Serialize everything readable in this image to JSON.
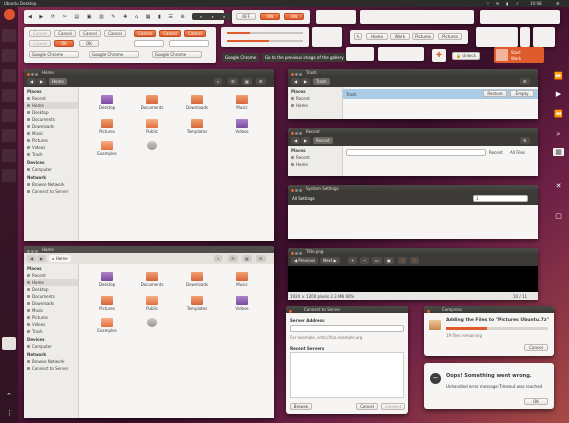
{
  "topbar": {
    "title": "Ubuntu Desktop",
    "clock": "10:08"
  },
  "launcher": {
    "items": [
      "home",
      "files",
      "browser",
      "software",
      "settings",
      "trash",
      "apps"
    ]
  },
  "widgets": {
    "cancel": "Cancel",
    "ok": "OK",
    "combo": "Google Chrome",
    "tooltip": "Google Chrome",
    "tooltip2": "Go to the previous image of the gallery",
    "path": [
      "Home",
      "Work",
      "Pictures"
    ],
    "crumb": "Pictures",
    "unlock": "Unlock",
    "user": {
      "name": "Start",
      "sub": "Work"
    }
  },
  "home1": {
    "title": "Home",
    "path": "Home",
    "places_h": "Places",
    "places": [
      "Recent",
      "Home",
      "Desktop",
      "Documents",
      "Downloads",
      "Music",
      "Pictures",
      "Videos",
      "Trash"
    ],
    "devices_h": "Devices",
    "devices": [
      "Computer"
    ],
    "network_h": "Network",
    "network": [
      "Browse Network",
      "Connect to Server"
    ],
    "files": [
      "Desktop",
      "Documents",
      "Downloads",
      "Music",
      "Pictures",
      "Public",
      "Templates",
      "Videos",
      "Examples",
      ""
    ]
  },
  "home2": {
    "title": "Home",
    "path": "Home"
  },
  "trash": {
    "title": "Trash",
    "path": "Trash",
    "places_h": "Places",
    "places": [
      "Recent",
      "Home"
    ],
    "label": "Trash",
    "restore": "Restore",
    "empty": "Empty"
  },
  "recent": {
    "title": "Recent",
    "places_h": "Places",
    "places": [
      "Recent",
      "Home"
    ],
    "search": "",
    "label": "Recent",
    "scope": "All Files"
  },
  "settings": {
    "title": "System Settings",
    "label": "All Settings",
    "value": "1"
  },
  "image": {
    "title": "Title.png",
    "prev": "Previous",
    "next": "Next",
    "status": "1920 × 1200 pixels  2.3 MB  60%",
    "pager": "10 / 11"
  },
  "connect": {
    "title": "Connect to Server",
    "addr_label": "Server Address",
    "addr_hint": "For example, smb://foo.example.org",
    "recent_label": "Recent Servers",
    "browse": "Browse",
    "cancel": "Cancel",
    "connect": "Connect"
  },
  "compress": {
    "title": "Compress",
    "msg": "Adding the Files to \"Pictures Ubuntu.7z\"",
    "sub": "19 files remaining",
    "cancel": "Cancel"
  },
  "error": {
    "title": "Oops! Something went wrong.",
    "sub": "Unhandled error message:Timeout was reached",
    "ok": "OK"
  },
  "colors": {
    "accent": "#e05b2b",
    "titlebar": "#3b3a37"
  }
}
